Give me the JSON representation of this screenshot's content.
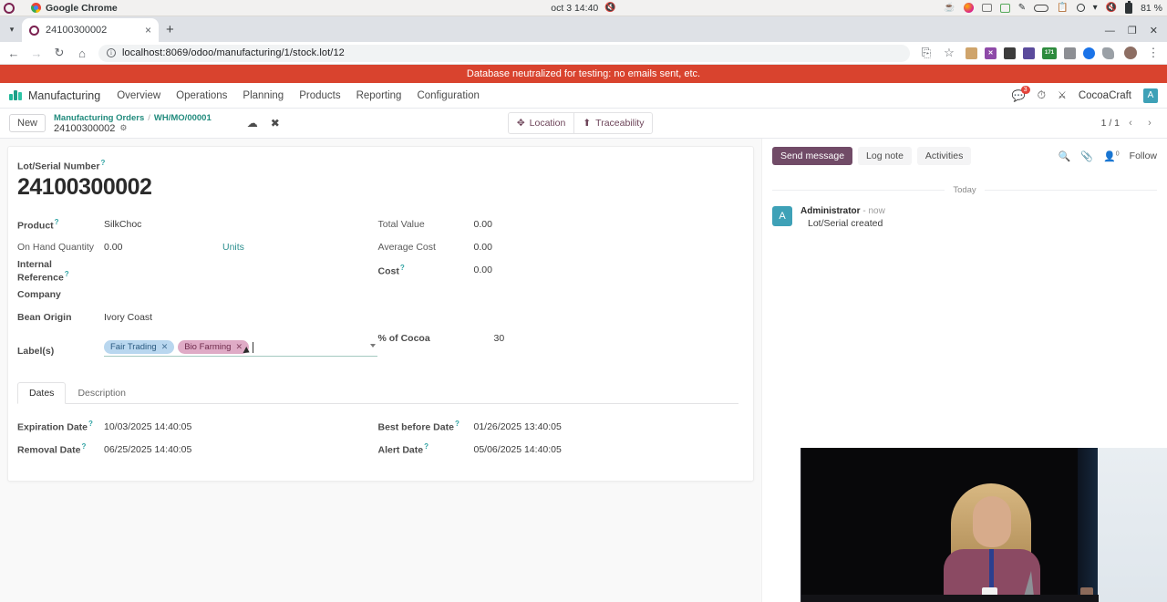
{
  "os_bar": {
    "app_name": "Google Chrome",
    "clock": "oct 3  14:40",
    "battery": "81 %",
    "icons": [
      "activities-dot",
      "chrome-icon",
      "notifications-muted-icon",
      "coffee-icon",
      "firefox-icon",
      "screenshot-icon",
      "messaging-icon",
      "edit-icon",
      "toggle-icon",
      "clipboard-icon",
      "location-icon",
      "wifi-icon",
      "volume-muted-icon",
      "battery-icon"
    ]
  },
  "browser": {
    "tab_title": "24100300002",
    "tab_close": "×",
    "new_tab": "+",
    "back": "←",
    "forward": "→",
    "reload": "↻",
    "home": "⌂",
    "url": "localhost:8069/odoo/manufacturing/1/stock.lot/12",
    "bookmark": "☆",
    "cast": "⎘",
    "menu": "⋮",
    "window_minimize": "—",
    "window_maximize": "❐",
    "window_close": "✕",
    "extensions": [
      {
        "name": "bank-extension",
        "color": "#cfa46b",
        "label": ""
      },
      {
        "name": "puzzle-extension",
        "color": "#8e4aa8",
        "label": "✕"
      },
      {
        "name": "doc-extension",
        "color": "#3c3c3c",
        "label": ""
      },
      {
        "name": "window-extension",
        "color": "#5b4b9c",
        "label": ""
      },
      {
        "name": "counter-extension",
        "color": "#2e8b3e",
        "label": "171"
      },
      {
        "name": "selection-extension",
        "color": "#5f6368",
        "label": ""
      },
      {
        "name": "blue-dot-extension",
        "color": "#1a73e8",
        "label": ""
      },
      {
        "name": "shape-extension",
        "color": "#5f6368",
        "label": ""
      }
    ]
  },
  "odoo": {
    "db_banner": "Database neutralized for testing: no emails sent, etc.",
    "app_name": "Manufacturing",
    "menus": [
      "Overview",
      "Operations",
      "Planning",
      "Products",
      "Reporting",
      "Configuration"
    ],
    "message_count": "3",
    "user_name": "CocoaCraft",
    "user_initial": "A",
    "clock_icon": "clock-icon",
    "tools_icon": "tools-icon"
  },
  "control_panel": {
    "new_label": "New",
    "breadcrumb_parent": "Manufacturing Orders",
    "breadcrumb_sep": "/",
    "breadcrumb_mid": "WH/MO/00001",
    "breadcrumb_current": "24100300002",
    "gear": "⚙",
    "save_icon": "cloud-save-icon",
    "discard_icon": "discard-icon",
    "buttons": [
      {
        "name": "location-button",
        "icon": "crosshair-icon",
        "label": "Location"
      },
      {
        "name": "traceability-button",
        "icon": "arrow-up-icon",
        "label": "Traceability"
      }
    ],
    "pager": "1 / 1",
    "prev": "‹",
    "next": "›"
  },
  "form": {
    "title_label": "Lot/Serial Number",
    "title_value": "24100300002",
    "left_fields": [
      {
        "label": "Product",
        "value": "SilkChoc",
        "tip": true
      },
      {
        "label": "On Hand Quantity",
        "value": "0.00",
        "tip": false,
        "suffix": "Units"
      },
      {
        "label": "Internal Reference",
        "value": "",
        "tip": true
      },
      {
        "label": "Company",
        "value": "",
        "tip": false
      },
      {
        "label": "Bean Origin",
        "value": "Ivory Coast",
        "tip": false
      }
    ],
    "right_fields": [
      {
        "label": "Total Value",
        "value": "0.00",
        "tip": false
      },
      {
        "label": "Average Cost",
        "value": "0.00",
        "tip": false
      },
      {
        "label": "Cost",
        "value": "0.00",
        "tip": true
      },
      {
        "label": "% of Cocoa",
        "value": "30",
        "tip": false
      }
    ],
    "labels_field": {
      "label": "Label(s)",
      "tags": [
        {
          "text": "Fair Trading",
          "style": "tag-blue",
          "remove": "✕"
        },
        {
          "text": "Bio Farming",
          "style": "tag-pink",
          "remove": "✕"
        }
      ]
    },
    "notebook": {
      "tabs": [
        {
          "label": "Dates",
          "active": true
        },
        {
          "label": "Description",
          "active": false
        }
      ],
      "dates": [
        {
          "label": "Expiration Date",
          "value": "10/03/2025 14:40:05",
          "tip": true
        },
        {
          "label": "Removal Date",
          "value": "06/25/2025 14:40:05",
          "tip": true
        },
        {
          "label": "Best before Date",
          "value": "01/26/2025 13:40:05",
          "tip": true
        },
        {
          "label": "Alert Date",
          "value": "05/06/2025 14:40:05",
          "tip": true
        }
      ]
    }
  },
  "chatter": {
    "send_message": "Send message",
    "log_note": "Log note",
    "activities": "Activities",
    "search_icon": "search-icon",
    "attachment_icon": "paperclip-icon",
    "followers_icon": "person-icon",
    "followers_count": "0",
    "follow_label": "Follow",
    "day_separator": "Today",
    "messages": [
      {
        "avatar": "A",
        "author": "Administrator",
        "time": "- now",
        "body": "Lot/Serial created"
      }
    ]
  },
  "colors": {
    "odoo_primary": "#714b67",
    "teal_link": "#218b7d",
    "db_banner_bg": "#d9432e",
    "tag_blue_bg": "#b9d7ef",
    "tag_pink_bg": "#dfabc6",
    "avatar_bg": "#3ea1b7"
  }
}
